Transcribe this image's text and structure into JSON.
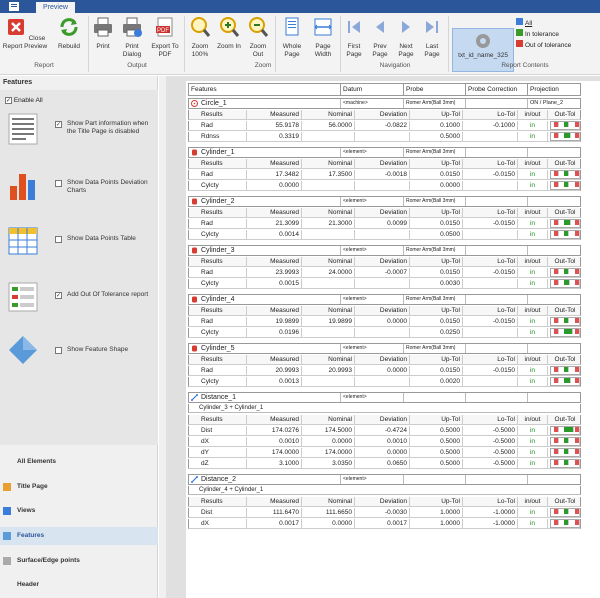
{
  "app": {
    "tab": "Preview",
    "app_btn": "■"
  },
  "ribbon": {
    "buttons": [
      {
        "label": "Close Report Preview",
        "icon": "close-report-icon"
      },
      {
        "label": "Rebuild",
        "icon": "rebuild-icon"
      },
      {
        "label": "Print",
        "icon": "print-icon"
      },
      {
        "label": "Print Dialog",
        "icon": "print-dialog-icon"
      },
      {
        "label": "Export To PDF",
        "icon": "pdf-icon"
      },
      {
        "label": "Zoom 100%",
        "icon": "zoom-100-icon"
      },
      {
        "label": "Zoom In",
        "icon": "zoom-in-icon"
      },
      {
        "label": "Zoom Out",
        "icon": "zoom-out-icon"
      },
      {
        "label": "Whole Page",
        "icon": "whole-page-icon"
      },
      {
        "label": "Page Width",
        "icon": "page-width-icon"
      },
      {
        "label": "First Page",
        "icon": "first-page-icon"
      },
      {
        "label": "Prev Page",
        "icon": "prev-page-icon"
      },
      {
        "label": "Next Page",
        "icon": "next-page-icon"
      },
      {
        "label": "Last Page",
        "icon": "last-page-icon"
      }
    ],
    "groups": {
      "report": "Report",
      "output": "Output",
      "zoom": "Zoom",
      "navigation": "Navigation",
      "report_contents": "Report Contents"
    },
    "selected_item": "txt_id_name_325",
    "filters": {
      "all": "All",
      "in_tol": "In tolerance",
      "out_tol": "Out of tolerance"
    }
  },
  "left": {
    "title": "Features",
    "enable_all": "Enable All",
    "options": [
      {
        "label": "Show Part information when the Title Page is disabled",
        "checked": true,
        "icon": "part-info-icon"
      },
      {
        "label": "Show Data Points Deviation Charts",
        "checked": false,
        "icon": "bar-chart-icon"
      },
      {
        "label": "Show Data Points Table",
        "checked": false,
        "icon": "table-icon"
      },
      {
        "label": "Add Out Of Tolerance report",
        "checked": true,
        "icon": "out-of-tolerance-icon"
      },
      {
        "label": "Show Feature Shape",
        "checked": false,
        "icon": "feature-shape-icon"
      }
    ],
    "nav": [
      "All Elements",
      "Title Page",
      "Views",
      "Features",
      "Surface/Edge points",
      "Header"
    ],
    "nav_selected": "Features"
  },
  "report": {
    "header": [
      "Features",
      "Datum",
      "Probe",
      "Probe Correction",
      "Projection"
    ],
    "col_headers": [
      "Results",
      "Measured",
      "Nominal",
      "Deviation",
      "Up-Tol",
      "Lo-Tol",
      "in/out",
      "Out-Tol"
    ],
    "features": [
      {
        "name": "Circle_1",
        "datum": "<machine>",
        "probe": "Romer Arm(Ball 3mm)",
        "projection": "ON / Plane_2",
        "icon": "circle-feature-icon",
        "rows": [
          {
            "r": "Rad",
            "m": "55.9178",
            "n": "56.0000",
            "d": "-0.0822",
            "u": "0.1000",
            "l": "-0.1000",
            "io": "in",
            "g": 0.2
          },
          {
            "r": "Rdnss",
            "m": "0.3319",
            "n": "",
            "d": "",
            "u": "0.5000",
            "l": "",
            "io": "in",
            "g": 0.6
          }
        ]
      },
      {
        "name": "Cylinder_1",
        "datum": "<element>",
        "probe": "Romer Arm(Ball 3mm)",
        "projection": "",
        "icon": "cylinder-feature-icon",
        "rows": [
          {
            "r": "Rad",
            "m": "17.3482",
            "n": "17.3500",
            "d": "-0.0018",
            "u": "0.0150",
            "l": "-0.0150",
            "io": "in",
            "g": 0.0
          },
          {
            "r": "Cylcty",
            "m": "0.0000",
            "n": "",
            "d": "",
            "u": "0.0000",
            "l": "",
            "io": "in",
            "g": 0.0
          }
        ]
      },
      {
        "name": "Cylinder_2",
        "datum": "<element>",
        "probe": "Romer Arm(Ball 3mm)",
        "projection": "",
        "icon": "cylinder-feature-icon",
        "rows": [
          {
            "r": "Rad",
            "m": "21.3099",
            "n": "21.3000",
            "d": "0.0099",
            "u": "0.0150",
            "l": "-0.0150",
            "io": "in",
            "g": 0.66
          },
          {
            "r": "Cylcty",
            "m": "0.0014",
            "n": "",
            "d": "",
            "u": "0.0500",
            "l": "",
            "io": "in",
            "g": 0.03
          }
        ]
      },
      {
        "name": "Cylinder_3",
        "datum": "<element>",
        "probe": "Romer Arm(Ball 3mm)",
        "projection": "",
        "icon": "cylinder-feature-icon",
        "rows": [
          {
            "r": "Rad",
            "m": "23.9993",
            "n": "24.0000",
            "d": "-0.0007",
            "u": "0.0150",
            "l": "-0.0150",
            "io": "in",
            "g": 0.0
          },
          {
            "r": "Cylcty",
            "m": "0.0015",
            "n": "",
            "d": "",
            "u": "0.0030",
            "l": "",
            "io": "in",
            "g": 0.5
          }
        ]
      },
      {
        "name": "Cylinder_4",
        "datum": "<element>",
        "probe": "Romer Arm(Ball 3mm)",
        "projection": "",
        "icon": "cylinder-feature-icon",
        "rows": [
          {
            "r": "Rad",
            "m": "19.9899",
            "n": "19.9899",
            "d": "0.0000",
            "u": "0.0150",
            "l": "-0.0150",
            "io": "in",
            "g": 0.0
          },
          {
            "r": "Cylcty",
            "m": "0.0196",
            "n": "",
            "d": "",
            "u": "0.0250",
            "l": "",
            "io": "in",
            "g": 0.78
          }
        ]
      },
      {
        "name": "Cylinder_5",
        "datum": "<element>",
        "probe": "Romer Arm(Ball 3mm)",
        "projection": "",
        "icon": "cylinder-feature-icon",
        "rows": [
          {
            "r": "Rad",
            "m": "20.9993",
            "n": "20.9993",
            "d": "0.0000",
            "u": "0.0150",
            "l": "-0.0150",
            "io": "in",
            "g": 0.0
          },
          {
            "r": "Cylcty",
            "m": "0.0013",
            "n": "",
            "d": "",
            "u": "0.0020",
            "l": "",
            "io": "in",
            "g": 0.65
          }
        ]
      },
      {
        "name": "Distance_1",
        "datum": "<element>",
        "probe": "",
        "projection": "",
        "icon": "distance-feature-icon",
        "sub": "Cylinder_3 + Cylinder_1",
        "rows": [
          {
            "r": "Dist",
            "m": "174.0276",
            "n": "174.5000",
            "d": "-0.4724",
            "u": "0.5000",
            "l": "-0.5000",
            "io": "in",
            "g": 0.94
          },
          {
            "r": "dX",
            "m": "0.0010",
            "n": "0.0000",
            "d": "0.0010",
            "u": "0.5000",
            "l": "-0.5000",
            "io": "in",
            "g": 0.0
          },
          {
            "r": "dY",
            "m": "174.0000",
            "n": "174.0000",
            "d": "0.0000",
            "u": "0.5000",
            "l": "-0.5000",
            "io": "in",
            "g": 0.0
          },
          {
            "r": "dZ",
            "m": "3.1000",
            "n": "3.0350",
            "d": "0.0650",
            "u": "0.5000",
            "l": "-0.5000",
            "io": "in",
            "g": 0.13
          }
        ]
      },
      {
        "name": "Distance_2",
        "datum": "<element>",
        "probe": "",
        "projection": "",
        "icon": "distance-feature-icon",
        "sub": "Cylinder_4 + Cylinder_1",
        "rows": [
          {
            "r": "Dist",
            "m": "111.6470",
            "n": "111.6650",
            "d": "-0.0030",
            "u": "1.0000",
            "l": "-1.0000",
            "io": "in",
            "g": 0.0
          },
          {
            "r": "dX",
            "m": "0.0017",
            "n": "0.0000",
            "d": "0.0017",
            "u": "1.0000",
            "l": "-1.0000",
            "io": "in",
            "g": 0.0
          }
        ]
      }
    ]
  }
}
